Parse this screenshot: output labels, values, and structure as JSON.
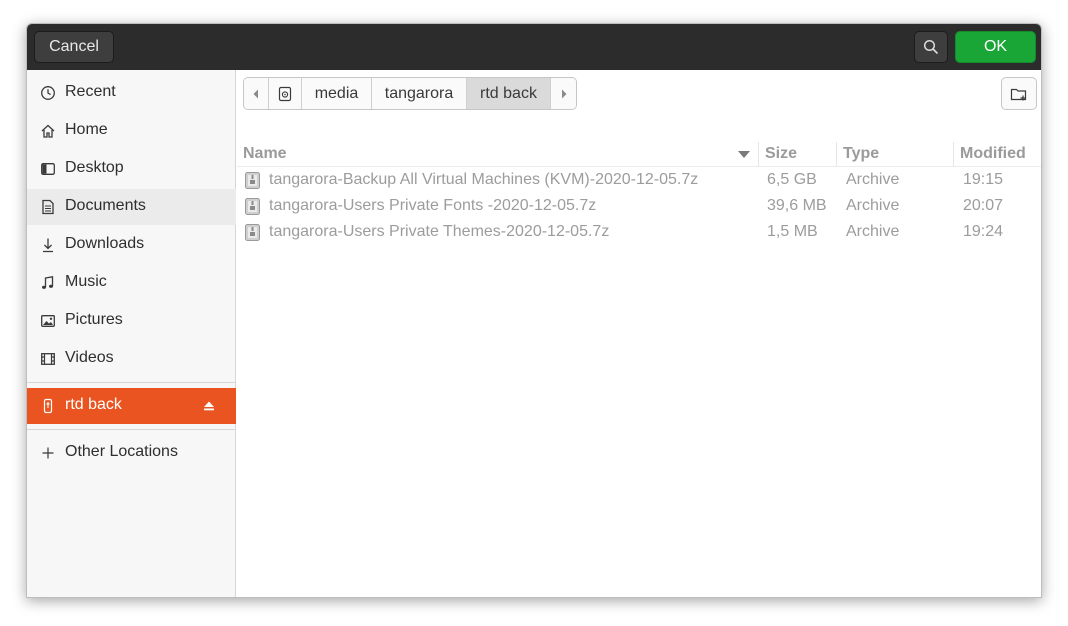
{
  "header": {
    "cancel_label": "Cancel",
    "ok_label": "OK"
  },
  "sidebar": {
    "items": [
      {
        "label": "Recent",
        "icon": "clock-icon"
      },
      {
        "label": "Home",
        "icon": "home-icon"
      },
      {
        "label": "Desktop",
        "icon": "desktop-icon"
      },
      {
        "label": "Documents",
        "icon": "document-icon"
      },
      {
        "label": "Downloads",
        "icon": "download-icon"
      },
      {
        "label": "Music",
        "icon": "music-icon"
      },
      {
        "label": "Pictures",
        "icon": "picture-icon"
      },
      {
        "label": "Videos",
        "icon": "video-icon"
      }
    ],
    "devices": [
      {
        "label": "rtd back",
        "icon": "usb-drive-icon"
      }
    ],
    "other": {
      "label": "Other Locations",
      "icon": "plus-icon"
    }
  },
  "pathbar": {
    "segments": [
      "media",
      "tangarora",
      "rtd back"
    ]
  },
  "columns": {
    "name": "Name",
    "size": "Size",
    "type": "Type",
    "modified": "Modified"
  },
  "files": [
    {
      "name": "tangarora-Backup All Virtual Machines (KVM)-2020-12-05.7z",
      "size": "6,5 GB",
      "type": "Archive",
      "modified": "19:15"
    },
    {
      "name": "tangarora-Users Private Fonts -2020-12-05.7z",
      "size": "39,6 MB",
      "type": "Archive",
      "modified": "20:07"
    },
    {
      "name": "tangarora-Users Private Themes-2020-12-05.7z",
      "size": "1,5 MB",
      "type": "Archive",
      "modified": "19:24"
    }
  ],
  "colors": {
    "header_bg": "#2c2c2c",
    "ok_green": "#19a636",
    "accent_orange": "#e95420"
  }
}
